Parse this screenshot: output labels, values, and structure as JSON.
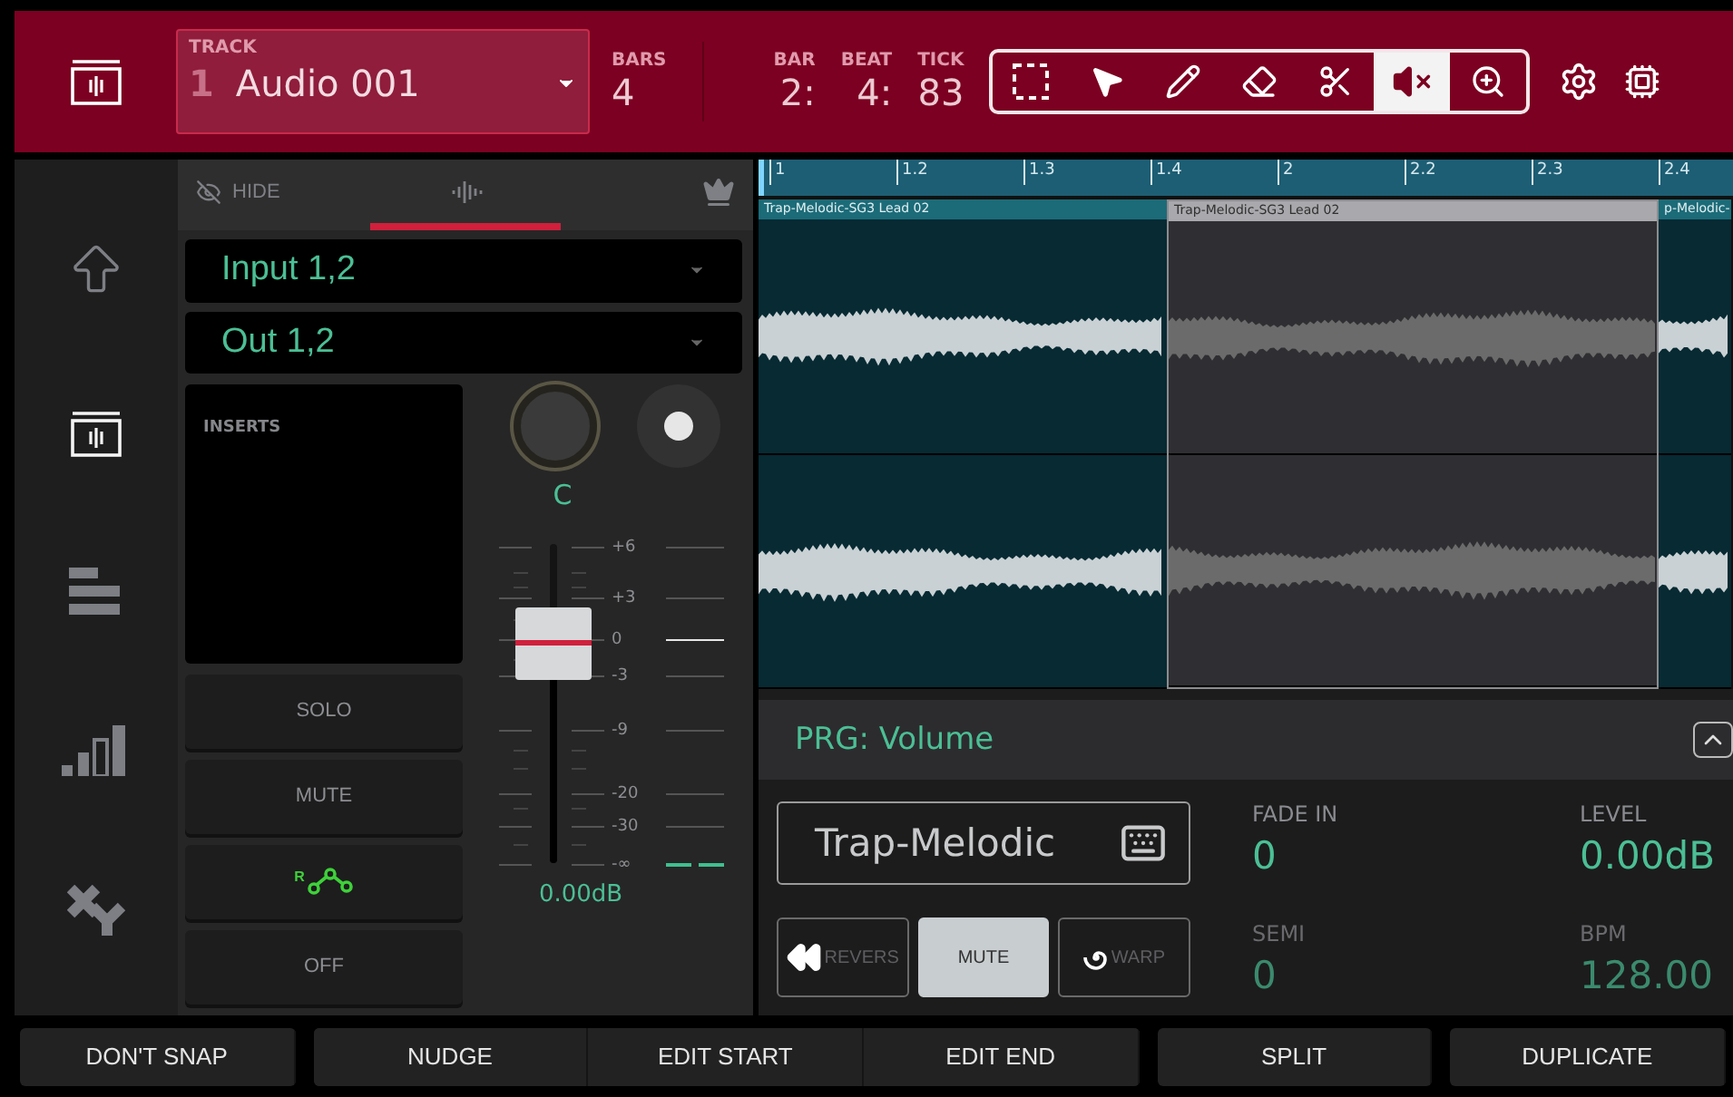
{
  "header": {
    "track_label": "TRACK",
    "track_number": "1",
    "track_name": "Audio 001",
    "bars_label": "BARS",
    "bars": "4",
    "position": [
      {
        "label": "BAR",
        "value": "2:"
      },
      {
        "label": "BEAT",
        "value": "4:"
      },
      {
        "label": "TICK",
        "value": "83"
      }
    ],
    "tools": [
      {
        "kind": "marquee",
        "selected": false
      },
      {
        "kind": "pointer",
        "selected": false
      },
      {
        "kind": "pencil",
        "selected": false
      },
      {
        "kind": "eraser",
        "selected": false
      },
      {
        "kind": "scissors",
        "selected": false
      },
      {
        "kind": "mute",
        "selected": true
      },
      {
        "kind": "zoom",
        "selected": false
      }
    ]
  },
  "sidebar": {
    "items": [
      {
        "kind": "up",
        "selected": false
      },
      {
        "kind": "wave",
        "selected": true
      },
      {
        "kind": "list",
        "selected": false
      },
      {
        "kind": "meter",
        "selected": false
      },
      {
        "kind": "xy",
        "selected": false
      }
    ]
  },
  "mixer": {
    "tabs": [
      {
        "kind": "hide",
        "label": "HIDE",
        "selected": false
      },
      {
        "kind": "wave",
        "selected": true
      },
      {
        "kind": "crown",
        "selected": false
      }
    ],
    "input": "Input 1,2",
    "output": "Out 1,2",
    "inserts_label": "INSERTS",
    "pan": "C",
    "buttons": [
      {
        "kind": "text",
        "label": "SOLO"
      },
      {
        "kind": "text",
        "label": "MUTE"
      },
      {
        "kind": "automation",
        "label": "R"
      },
      {
        "kind": "text",
        "label": "OFF"
      }
    ],
    "fader": {
      "level": 0.69,
      "scale": [
        "+6",
        "+3",
        "0",
        "-3",
        "-9",
        "-20",
        "-30",
        "-∞"
      ]
    },
    "volume": "0.00dB"
  },
  "timeline": {
    "ruler": [
      "1",
      "1.2",
      "1.3",
      "1.4",
      "2",
      "2.2",
      "2.3",
      "2.4"
    ],
    "clips": [
      {
        "label": "Trap-Melodic-SG3 Lead 02",
        "selected": false
      },
      {
        "label": "Trap-Melodic-SG3 Lead 02",
        "selected": true
      },
      {
        "label": "p-Melodic-",
        "selected": false
      }
    ]
  },
  "editor": {
    "program": "PRG: Volume",
    "clip_name": "Trap-Melodic",
    "buttons": [
      {
        "kind": "reverse",
        "label": "REVERS",
        "selected": false
      },
      {
        "kind": "text",
        "label": "MUTE",
        "selected": true
      },
      {
        "kind": "warp",
        "label": "WARP",
        "selected": false
      }
    ],
    "params": [
      {
        "label": "FADE IN",
        "value": "0",
        "disabled": false
      },
      {
        "label": "LEVEL",
        "value": "0.00dB",
        "disabled": false
      },
      {
        "label": "SEMI",
        "value": "0",
        "disabled": true
      },
      {
        "label": "BPM",
        "value": "128.00",
        "disabled": true
      }
    ]
  },
  "footer": [
    [
      "DON'T SNAP"
    ],
    [
      "NUDGE",
      "EDIT START",
      "EDIT END"
    ],
    [
      "SPLIT"
    ],
    [
      "DUPLICATE"
    ]
  ]
}
